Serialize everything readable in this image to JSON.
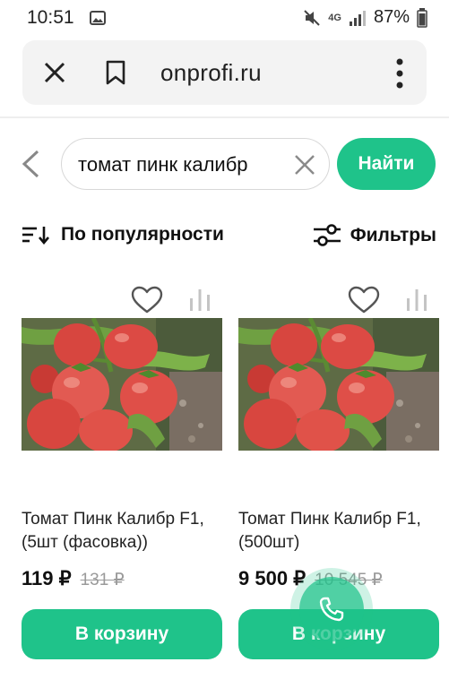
{
  "status_bar": {
    "time": "10:51",
    "network": "4G",
    "battery": "87%"
  },
  "browser": {
    "url": "onprofi.ru"
  },
  "search": {
    "query": "томат пинк калибр",
    "button_label": "Найти"
  },
  "sort": {
    "label": "По популярности"
  },
  "filter": {
    "label": "Фильтры"
  },
  "products": [
    {
      "title": "Томат Пинк Калибр F1, (5шт (фасовка))",
      "price": "119 ₽",
      "old_price": "131 ₽",
      "cart_label": "В корзину"
    },
    {
      "title": "Томат Пинк Калибр F1, (500шт)",
      "price": "9 500 ₽",
      "old_price": "10 545 ₽",
      "cart_label": "В корзину"
    }
  ],
  "colors": {
    "accent": "#1fc38a",
    "old_price": "#9a9a9a"
  }
}
